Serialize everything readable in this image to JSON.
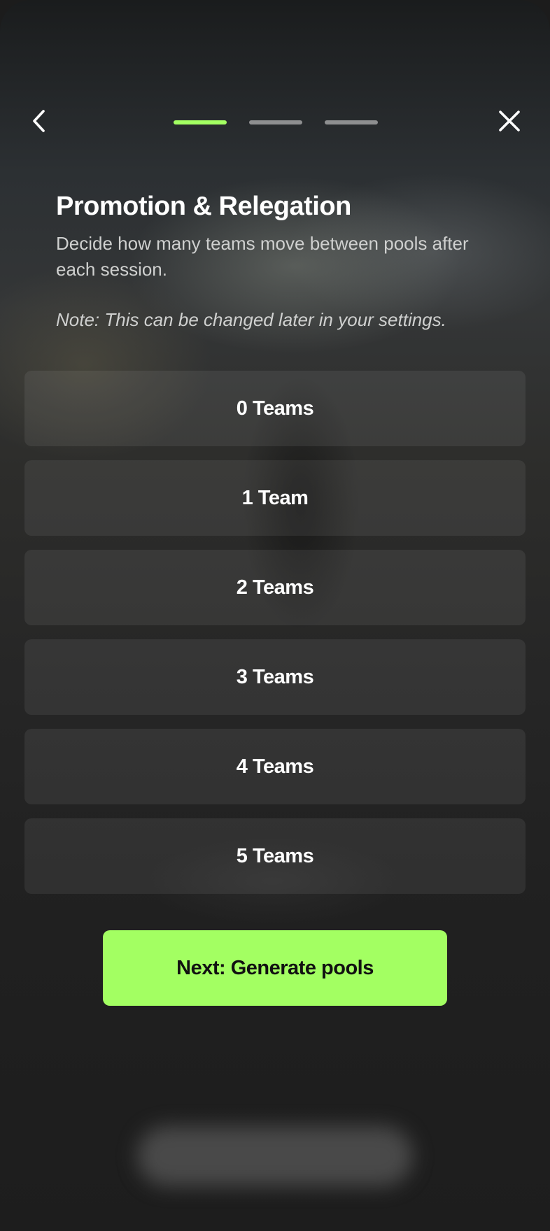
{
  "header": {
    "back_icon": "chevron-left-icon",
    "close_icon": "close-icon",
    "progress": {
      "total_steps": 3,
      "current_step": 1,
      "active_color": "#a3ff62",
      "inactive_color": "#8e8f90"
    }
  },
  "content": {
    "title": "Promotion & Relegation",
    "description": "Decide how many teams move between pools after each session.",
    "note": "Note: This can be changed later in your settings."
  },
  "options": [
    {
      "label": "0 Teams"
    },
    {
      "label": "1 Team"
    },
    {
      "label": "2 Teams"
    },
    {
      "label": "3 Teams"
    },
    {
      "label": "4 Teams"
    },
    {
      "label": "5 Teams"
    }
  ],
  "footer": {
    "next_label": "Next: Generate pools",
    "accent_color": "#a3ff62"
  }
}
